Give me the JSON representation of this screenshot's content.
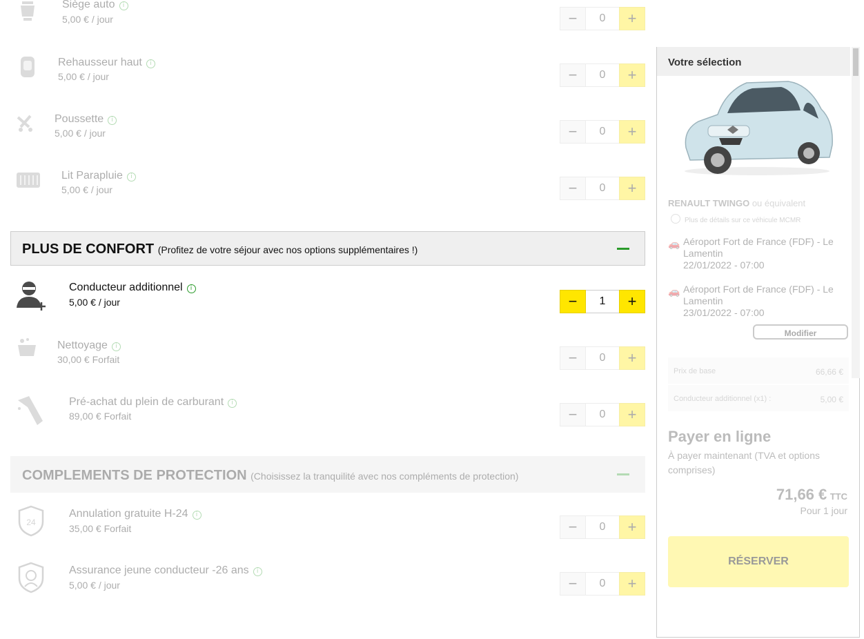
{
  "options_top": [
    {
      "name": "Siège auto",
      "price": "5,00 € / jour",
      "qty": "0"
    },
    {
      "name": "Rehausseur haut",
      "price": "5,00 € / jour",
      "qty": "0"
    },
    {
      "name": "Poussette",
      "price": "5,00 € / jour",
      "qty": "0"
    },
    {
      "name": "Lit Parapluie",
      "price": "5,00 € / jour",
      "qty": "0"
    }
  ],
  "section_confort": {
    "title": "PLUS DE CONFORT",
    "subtitle": "(Profitez de votre séjour avec nos options supplémentaires !)"
  },
  "options_confort": [
    {
      "name": "Conducteur additionnel",
      "price": "5,00 € / jour",
      "qty": "1"
    },
    {
      "name": "Nettoyage",
      "price": "30,00 € Forfait",
      "qty": "0"
    },
    {
      "name": "Pré-achat du plein de carburant",
      "price": "89,00 € Forfait",
      "qty": "0"
    }
  ],
  "section_protection": {
    "title": "COMPLEMENTS DE PROTECTION",
    "subtitle": "(Choisissez la tranquilité avec nos compléments de protection)"
  },
  "options_protection": [
    {
      "name": "Annulation gratuite H-24",
      "price": "35,00 € Forfait",
      "qty": "0"
    },
    {
      "name": "Assurance jeune conducteur -26 ans",
      "price": "5,00 € / jour",
      "qty": "0"
    }
  ],
  "stepper": {
    "minus": "−",
    "plus": "+"
  },
  "info_glyph": "i",
  "sidebar": {
    "title": "Votre sélection",
    "car_model": "RENAULT TWINGO",
    "car_equiv": "ou équivalent",
    "car_details": "Plus de détails sur ce véhicule MCMR",
    "pickup": {
      "place": "Aéroport Fort de France (FDF) - Le Lamentin",
      "date": "22/01/2022 - 07:00"
    },
    "dropoff": {
      "place": "Aéroport Fort de France (FDF) - Le Lamentin",
      "date": "23/01/2022 - 07:00"
    },
    "modify_label": "Modifier",
    "price_lines": [
      {
        "label": "Prix de base",
        "value": "66,66 €"
      },
      {
        "label": "Conducteur additionnel (x1) :",
        "value": "5,00 €"
      }
    ],
    "pay_title": "Payer en ligne",
    "pay_sub": "À payer maintenant (TVA et options comprises)",
    "total": "71,66 €",
    "ttc": "TTC",
    "per": "Pour 1 jour",
    "reserve_label": "RÉSERVER"
  },
  "colors": {
    "accent": "#ffe600",
    "green": "#2a9a2a"
  }
}
